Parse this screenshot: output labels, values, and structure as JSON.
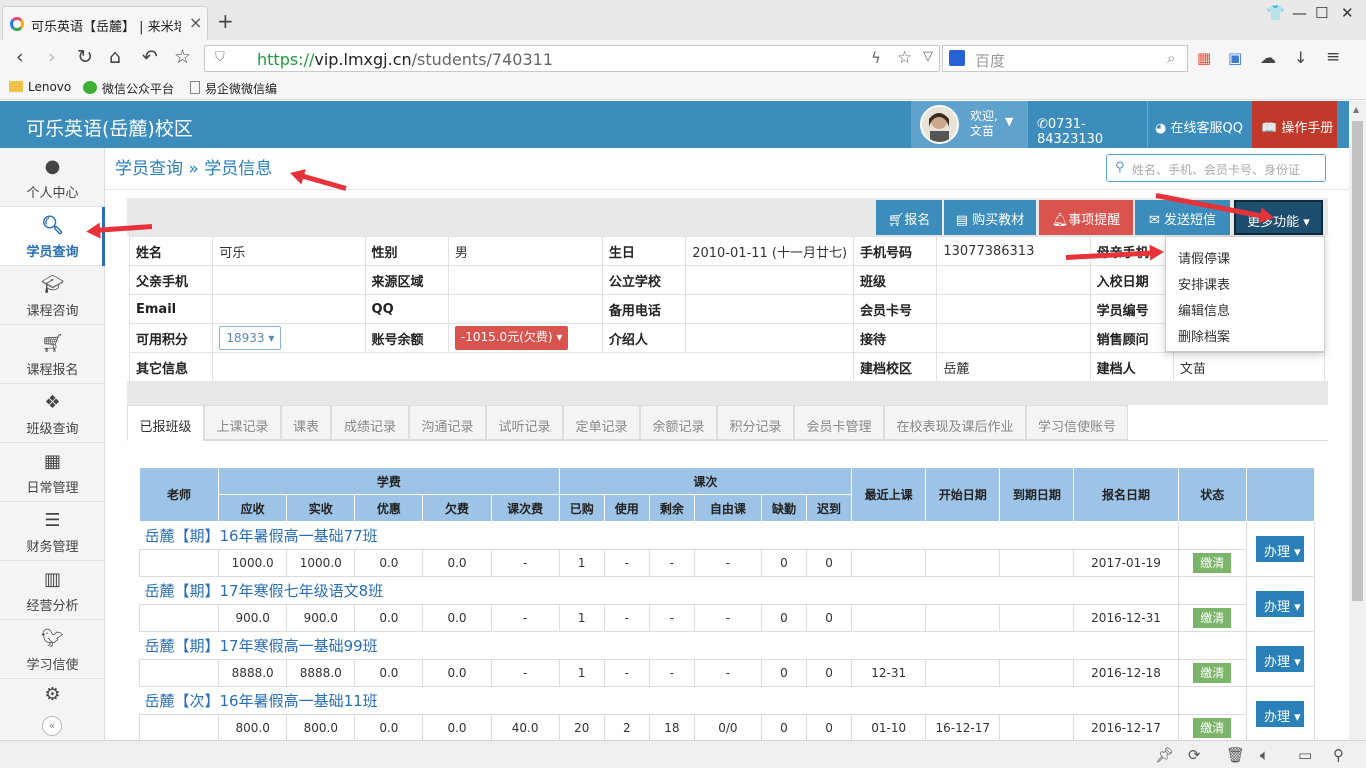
{
  "browser": {
    "tab_title": "可乐英语【岳麓】 | 来米培训",
    "url_https": "https://",
    "url_host": "vip.lmxgj.cn",
    "url_path": "/students/740311",
    "search_placeholder": "百度",
    "bookmarks": [
      "Lenovo",
      "微信公众平台",
      "易企微微信编"
    ]
  },
  "header": {
    "brand": "可乐英语(岳麓)校区",
    "welcome_line1": "欢迎,",
    "welcome_line2": "文苗",
    "phone": "0731-84323130",
    "qq": "在线客服QQ",
    "manual": "操作手册"
  },
  "sidebar": {
    "items": [
      {
        "label": "个人中心",
        "icon": "user-icon"
      },
      {
        "label": "学员查询",
        "icon": "search-icon"
      },
      {
        "label": "课程咨询",
        "icon": "graduation-cap-icon"
      },
      {
        "label": "课程报名",
        "icon": "cart-icon"
      },
      {
        "label": "班级查询",
        "icon": "cubes-icon"
      },
      {
        "label": "日常管理",
        "icon": "calendar-icon"
      },
      {
        "label": "财务管理",
        "icon": "list-icon"
      },
      {
        "label": "经营分析",
        "icon": "bar-chart-icon"
      },
      {
        "label": "学习信使",
        "icon": "twitter-icon"
      }
    ]
  },
  "breadcrumb": "学员查询 » 学员信息",
  "top_search_placeholder": "姓名、手机、会员卡号、身份证",
  "actions": {
    "enroll": "报名",
    "buy_books": "购买教材",
    "reminder": "事项提醒",
    "sms": "发送短信",
    "more": "更多功能"
  },
  "more_menu": [
    "请假停课",
    "安排课表",
    "编辑信息",
    "删除档案"
  ],
  "student": {
    "rows": [
      [
        {
          "k": "姓名",
          "v": "可乐"
        },
        {
          "k": "性别",
          "v": "男"
        },
        {
          "k": "生日",
          "v": "2010-01-11 (十一月廿七)"
        },
        {
          "k": "手机号码",
          "v": "13077386313"
        },
        {
          "k": "母亲手机",
          "v": ""
        }
      ],
      [
        {
          "k": "父亲手机",
          "v": ""
        },
        {
          "k": "来源区域",
          "v": ""
        },
        {
          "k": "公立学校",
          "v": ""
        },
        {
          "k": "班级",
          "v": ""
        },
        {
          "k": "入校日期",
          "v": ""
        }
      ],
      [
        {
          "k": "Email",
          "v": ""
        },
        {
          "k": "QQ",
          "v": ""
        },
        {
          "k": "备用电话",
          "v": ""
        },
        {
          "k": "会员卡号",
          "v": ""
        },
        {
          "k": "学员编号",
          "v": ""
        }
      ],
      [
        {
          "k": "可用积分",
          "v": "18933"
        },
        {
          "k": "账号余额",
          "v": "-1015.0元(欠费)"
        },
        {
          "k": "介绍人",
          "v": ""
        },
        {
          "k": "接待",
          "v": ""
        },
        {
          "k": "销售顾问",
          "v": ""
        }
      ],
      [
        {
          "k": "其它信息",
          "v": ""
        },
        {
          "k": "建档校区",
          "v": "岳麓"
        },
        {
          "k": "建档人",
          "v": "文苗"
        }
      ]
    ]
  },
  "tabs": [
    "已报班级",
    "上课记录",
    "课表",
    "成绩记录",
    "沟通记录",
    "试听记录",
    "定单记录",
    "余额记录",
    "积分记录",
    "会员卡管理",
    "在校表现及课后作业",
    "学习信使账号"
  ],
  "class_table": {
    "header_groups": {
      "teacher": "老师",
      "fee": "学费",
      "lessons": "课次",
      "last": "最近上课",
      "start": "开始日期",
      "end": "到期日期",
      "signup": "报名日期",
      "status": "状态"
    },
    "fee_cols": [
      "应收",
      "实收",
      "优惠",
      "欠费",
      "课次费"
    ],
    "lesson_cols": [
      "已购",
      "使用",
      "剩余",
      "自由课",
      "缺勤",
      "迟到"
    ],
    "pay_label": "缴清",
    "handle_label": "办理",
    "rows": [
      {
        "name": "岳麓【期】16年暑假高一基础77班",
        "cells": [
          "",
          "1000.0",
          "1000.0",
          "0.0",
          "0.0",
          "-",
          "1",
          "-",
          "-",
          "-",
          "0",
          "0",
          "",
          "",
          "",
          "2017-01-19"
        ]
      },
      {
        "name": "岳麓【期】17年寒假七年级语文8班",
        "cells": [
          "",
          "900.0",
          "900.0",
          "0.0",
          "0.0",
          "-",
          "1",
          "-",
          "-",
          "-",
          "0",
          "0",
          "",
          "",
          "",
          "2016-12-31"
        ]
      },
      {
        "name": "岳麓【期】17年寒假高一基础99班",
        "cells": [
          "",
          "8888.0",
          "8888.0",
          "0.0",
          "0.0",
          "-",
          "1",
          "-",
          "-",
          "-",
          "0",
          "0",
          "12-31",
          "",
          "",
          "2016-12-18"
        ]
      },
      {
        "name": "岳麓【次】16年暑假高一基础11班",
        "cells": [
          "",
          "800.0",
          "800.0",
          "0.0",
          "0.0",
          "40.0",
          "20",
          "2",
          "18",
          "0/0",
          "0",
          "0",
          "01-10",
          "16-12-17",
          "",
          "2016-12-17"
        ]
      }
    ]
  },
  "colors": {
    "primary": "#3c8dbc",
    "danger": "#c0392b",
    "dark": "#1e4e6e",
    "pay": "#7cb46a",
    "th": "#9dc3e6"
  }
}
